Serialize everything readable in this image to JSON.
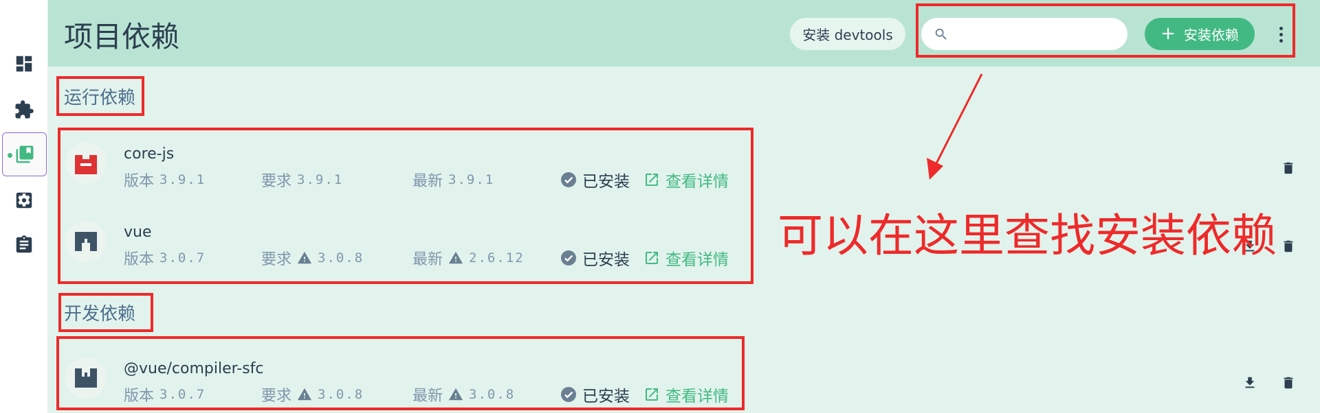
{
  "sidebar": {
    "items": [
      {
        "icon": "dashboard-icon",
        "active": false
      },
      {
        "icon": "puzzle-plugins-icon",
        "active": false
      },
      {
        "icon": "library-dependencies-icon",
        "active": true
      },
      {
        "icon": "gear-settings-icon",
        "active": false
      },
      {
        "icon": "clipboard-tasks-icon",
        "active": false
      }
    ]
  },
  "header": {
    "title": "项目依赖",
    "devtools_label": "安装 devtools",
    "search_placeholder": "",
    "install_label": "安装依赖",
    "install_icon": "+"
  },
  "sections": {
    "runtime_title": "运行依赖",
    "dev_title": "开发依赖"
  },
  "labels": {
    "version": "版本",
    "wanted": "要求",
    "latest": "最新",
    "installed": "已安装",
    "details": "查看详情"
  },
  "dependencies": {
    "runtime": [
      {
        "name": "core-js",
        "version": "3.9.1",
        "wanted": "3.9.1",
        "latest": "3.9.1",
        "wanted_warning": false,
        "latest_warning": false,
        "logo_color": "#dd3333"
      },
      {
        "name": "vue",
        "version": "3.0.7",
        "wanted": "3.0.8",
        "latest": "2.6.12",
        "wanted_warning": true,
        "latest_warning": true,
        "logo_color": "#3e5366"
      }
    ],
    "dev": [
      {
        "name": "@vue/compiler-sfc",
        "version": "3.0.7",
        "wanted": "3.0.8",
        "latest": "3.0.8",
        "wanted_warning": true,
        "latest_warning": true,
        "logo_color": "#3e5366"
      }
    ]
  },
  "annotation": {
    "text": "可以在这里查找安装依赖",
    "color": "#ee2a2a"
  },
  "colors": {
    "accent": "#42b983",
    "header_bg": "#b9e4d3",
    "main_bg": "#e1f3ec",
    "text": "#2c3e50",
    "muted": "#7f97ad",
    "section_title": "#4e6e8e"
  }
}
